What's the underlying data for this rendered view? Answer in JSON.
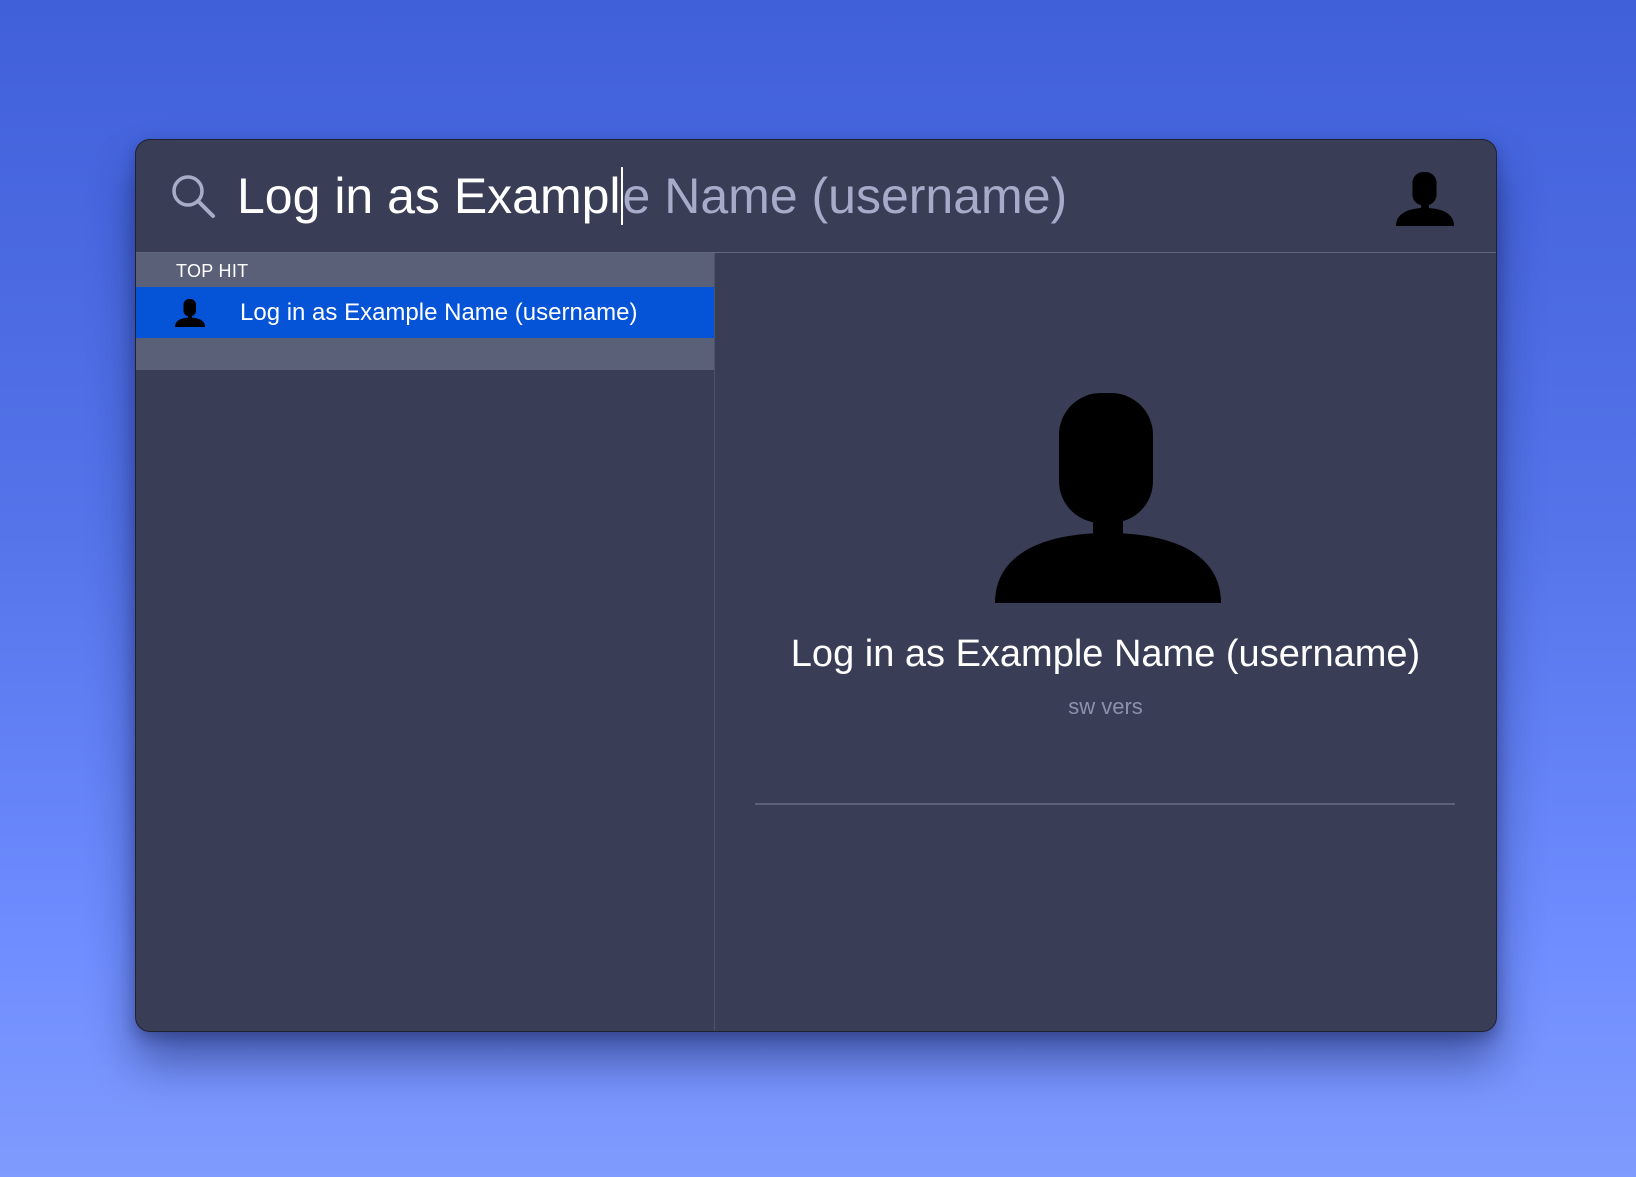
{
  "search": {
    "typed_text": "Log in as Exampl",
    "completion_text": "e Name (username)",
    "icon": "search-icon",
    "trailing_icon": "user-silhouette-icon"
  },
  "results": {
    "section_title": "TOP HIT",
    "items": [
      {
        "label": "Log in as Example Name (username)",
        "icon": "user-silhouette-icon",
        "selected": true
      }
    ]
  },
  "preview": {
    "icon": "user-silhouette-icon",
    "title": "Log in as Example Name (username)",
    "subtitle": "sw vers"
  },
  "colors": {
    "background_top": "#4060da",
    "background_bottom": "#7f9bfd",
    "panel": "#393d56",
    "section_header": "#5a6078",
    "selection": "#0553d6",
    "completion_text": "#a5abc8",
    "subtitle_text": "#8c91ad"
  }
}
